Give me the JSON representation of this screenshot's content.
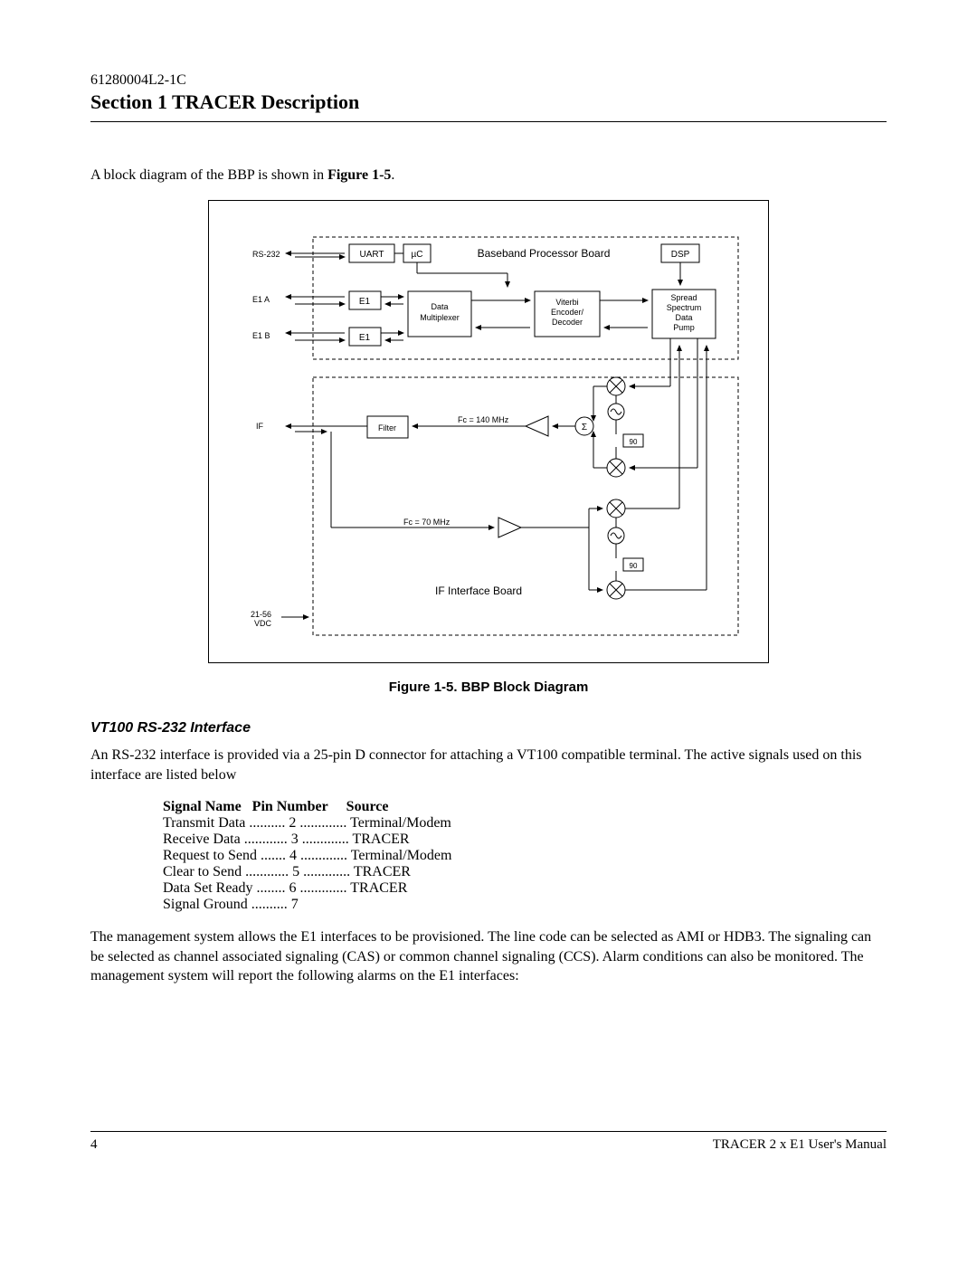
{
  "header": {
    "doc_number": "61280004L2-1C",
    "section_title": "Section 1  TRACER Description"
  },
  "intro": {
    "text_prefix": "A block diagram of the BBP is shown in ",
    "figure_ref": "Figure 1-5",
    "text_suffix": "."
  },
  "diagram": {
    "labels": {
      "rs232": "RS-232",
      "e1a": "E1  A",
      "e1b": "E1  B",
      "if": "IF",
      "vdc": "21-56\nVDC",
      "uart": "UART",
      "uc": "µC",
      "bbp_title": "Baseband Processor Board",
      "dsp": "DSP",
      "e1_box": "E1",
      "data_mux1": "Data",
      "data_mux2": "Multiplexer",
      "viterbi1": "Viterbi",
      "viterbi2": "Encoder/",
      "viterbi3": "Decoder",
      "spread1": "Spread",
      "spread2": "Spectrum",
      "spread3": "Data",
      "spread4": "Pump",
      "filter": "Filter",
      "fc140": "Fc = 140 MHz",
      "fc70": "Fc = 70 MHz",
      "sigma": "Σ",
      "ninety": "90",
      "if_board": "IF Interface Board"
    }
  },
  "figure_caption": "Figure 1-5.  BBP Block Diagram",
  "vt100": {
    "heading": "VT100 RS-232 Interface",
    "para": "An RS-232 interface is provided via a 25-pin D connector for attaching a VT100 compatible terminal. The active signals used on this interface are listed below"
  },
  "signal_table": {
    "header": {
      "col1": "Signal Name",
      "col2": "Pin Number",
      "col3": "Source"
    },
    "rows": [
      {
        "name": "Transmit Data",
        "pin": "2",
        "source": "Terminal/Modem"
      },
      {
        "name": "Receive Data",
        "pin": "3",
        "source": "TRACER"
      },
      {
        "name": "Request to Send",
        "pin": "4",
        "source": "Terminal/Modem"
      },
      {
        "name": "Clear to Send",
        "pin": "5",
        "source": "TRACER"
      },
      {
        "name": "Data Set Ready",
        "pin": "6",
        "source": "TRACER"
      },
      {
        "name": "Signal Ground",
        "pin": "7",
        "source": ""
      }
    ]
  },
  "mgmt_para": "The management system allows the E1 interfaces to be provisioned. The line code can be selected as AMI or HDB3. The signaling can be selected as channel associated signaling (CAS) or common channel signaling (CCS). Alarm conditions can also be monitored. The management system will report the following alarms on the E1 interfaces:",
  "footer": {
    "page": "4",
    "manual": "TRACER 2 x E1 User's Manual"
  }
}
